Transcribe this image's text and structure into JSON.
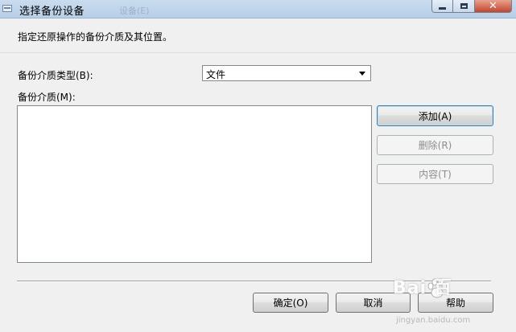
{
  "window": {
    "title": "选择备份设备",
    "background_ghost_text": "设备(E)",
    "controls": {
      "minimize_icon": "minimize-icon",
      "maximize_icon": "maximize-icon",
      "close_icon": "close-icon",
      "close_glyph": "✕"
    }
  },
  "instruction": "指定还原操作的备份介质及其位置。",
  "media_type": {
    "label": "备份介质类型(B):",
    "selected": "文件",
    "options": [
      "文件"
    ]
  },
  "media_list": {
    "label": "备份介质(M):",
    "items": []
  },
  "side_buttons": {
    "add": "添加(A)",
    "remove": "删除(R)",
    "contents": "内容(T)"
  },
  "footer_buttons": {
    "ok": "确定(O)",
    "cancel": "取消",
    "help": "帮助"
  },
  "watermark": {
    "text": "Bai 百",
    "sub": "jingyan.baidu.com"
  },
  "colors": {
    "title_bar": "#b7cfe8",
    "close_button": "#c4452b",
    "dialog_background": "#f0f0f0",
    "disabled_text": "#8d8d8d"
  }
}
